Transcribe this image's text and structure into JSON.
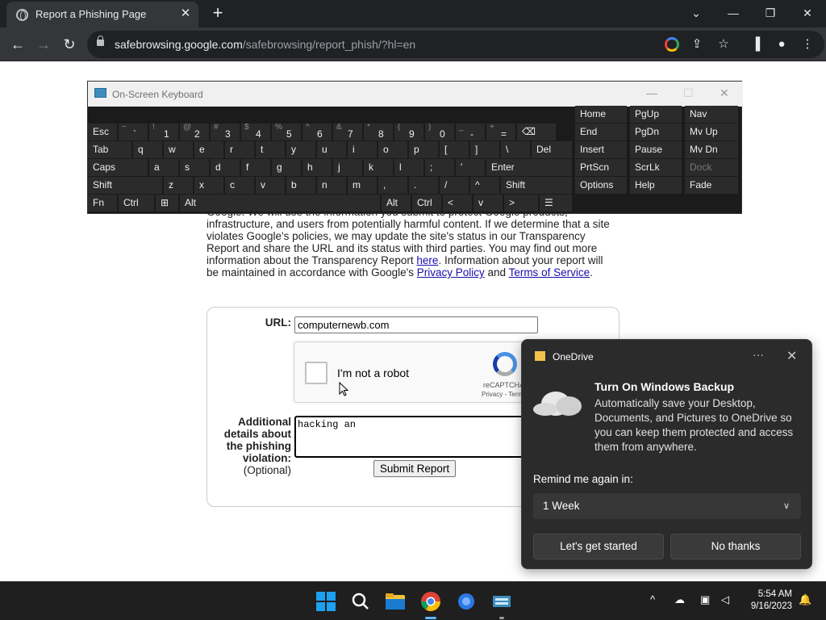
{
  "browser": {
    "tab_title": "Report a Phishing Page",
    "url_host": "safebrowsing.google.com",
    "url_path": "/safebrowsing/report_phish/?hl=en"
  },
  "page": {
    "intro_pre": "Google. We will use the information you submit to protect Google products, infrastructure, and users from potentially harmful content. If we determine that a site violates Google's policies, we may update the site's status in our Transparency Report and share the URL and its status with third parties. You may find out more information about the Transparency Report ",
    "link_here": "here",
    "intro_mid": ". Information about your report will be maintained in accordance with Google's ",
    "link_privacy": "Privacy Policy",
    "intro_and": " and ",
    "link_terms": "Terms of Service",
    "intro_end": ".",
    "url_label": "URL:",
    "url_value": "computernewb.com",
    "captcha_label": "I'm not a robot",
    "captcha_brand": "reCAPTCHA",
    "captcha_terms": "Privacy - Terms",
    "details_label_1": "Additional",
    "details_label_2": "details about",
    "details_label_3": "the phishing",
    "details_label_4": "violation:",
    "details_optional": "(Optional)",
    "details_value": "hacking an",
    "submit_label": "Submit Report"
  },
  "osk": {
    "title": "On-Screen Keyboard",
    "row1": [
      {
        "sup": "",
        "main": "Esc"
      },
      {
        "sup": "~",
        "main": "`"
      },
      {
        "sup": "!",
        "main": "1"
      },
      {
        "sup": "@",
        "main": "2"
      },
      {
        "sup": "#",
        "main": "3"
      },
      {
        "sup": "$",
        "main": "4"
      },
      {
        "sup": "%",
        "main": "5"
      },
      {
        "sup": "^",
        "main": "6"
      },
      {
        "sup": "&",
        "main": "7"
      },
      {
        "sup": "*",
        "main": "8"
      },
      {
        "sup": "(",
        "main": "9"
      },
      {
        "sup": ")",
        "main": "0"
      },
      {
        "sup": "_",
        "main": "-"
      },
      {
        "sup": "+",
        "main": "="
      },
      {
        "sup": "",
        "main": "⌫"
      }
    ],
    "row2": [
      "Tab",
      "q",
      "w",
      "e",
      "r",
      "t",
      "y",
      "u",
      "i",
      "o",
      "p",
      "[",
      "]",
      "\\",
      "Del"
    ],
    "row3": [
      "Caps",
      "a",
      "s",
      "d",
      "f",
      "g",
      "h",
      "j",
      "k",
      "l",
      ";",
      "'",
      "Enter"
    ],
    "row4": [
      "Shift",
      "z",
      "x",
      "c",
      "v",
      "b",
      "n",
      "m",
      ",",
      ".",
      "/",
      "^",
      "Shift"
    ],
    "row5": [
      "Fn",
      "Ctrl",
      "⊞",
      "Alt",
      "Alt",
      "Ctrl",
      "<",
      "v",
      ">",
      "☰"
    ],
    "nav_col1": [
      "Home",
      "End",
      "Insert",
      "PrtScn",
      "Options"
    ],
    "nav_col2": [
      "PgUp",
      "PgDn",
      "Pause",
      "ScrLk",
      "Help"
    ],
    "nav_col3": [
      "Nav",
      "Mv Up",
      "Mv Dn",
      "Dock",
      "Fade"
    ]
  },
  "toast": {
    "app": "OneDrive",
    "more": "···",
    "close": "✕",
    "heading": "Turn On Windows Backup",
    "body": "Automatically save your Desktop, Documents, and Pictures to OneDrive so you can keep them protected and access them from anywhere.",
    "remind_label": "Remind me again in:",
    "remind_value": "1 Week",
    "primary_button": "Let's get started",
    "secondary_button": "No thanks"
  },
  "taskbar": {
    "time": "5:54 AM",
    "date": "9/16/2023"
  }
}
